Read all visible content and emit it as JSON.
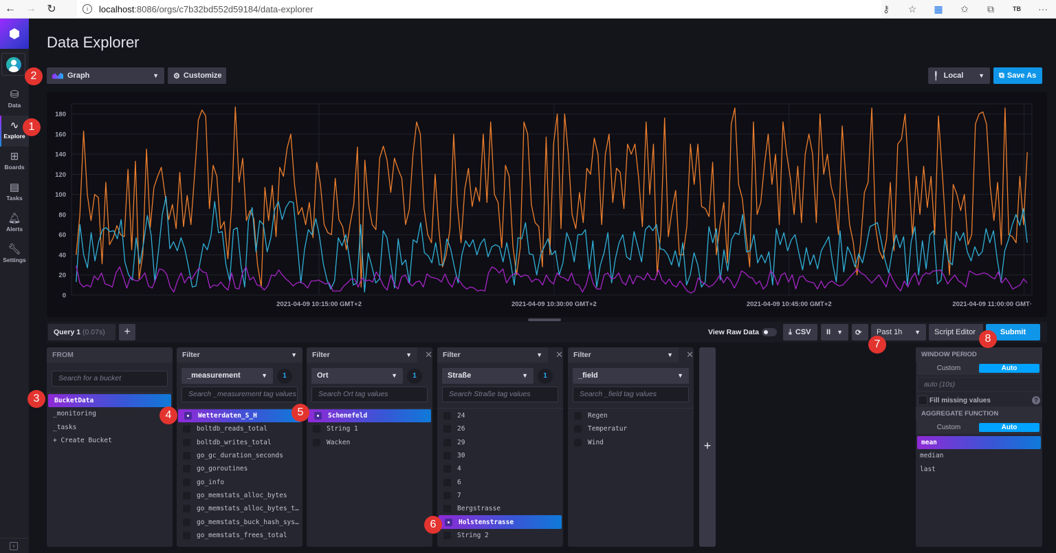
{
  "browser": {
    "url_host": "localhost",
    "url_path": ":8086/orgs/c7b32bd552d59184/data-explorer",
    "profile_initials": "TB"
  },
  "sidebar": {
    "items": [
      {
        "label": "Data",
        "icon": "database-icon"
      },
      {
        "label": "Explore",
        "icon": "explore-graph-icon",
        "active": true
      },
      {
        "label": "Boards",
        "icon": "dashboard-icon"
      },
      {
        "label": "Tasks",
        "icon": "calendar-icon"
      },
      {
        "label": "Alerts",
        "icon": "bell-icon"
      },
      {
        "label": "Settings",
        "icon": "wrench-icon"
      }
    ]
  },
  "page": {
    "title": "Data Explorer",
    "vis_type": "Graph",
    "customize_label": "Customize",
    "timezone": "Local",
    "save_as_label": "Save As"
  },
  "query_bar": {
    "query_tab": "Query 1",
    "query_time": "(0.07s)",
    "add_label": "+",
    "view_raw_label": "View Raw Data",
    "view_raw_on": false,
    "csv_label": "CSV",
    "pause_label": "II",
    "time_range": "Past 1h",
    "script_editor_label": "Script Editor",
    "submit_label": "Submit"
  },
  "from": {
    "header": "FROM",
    "search_placeholder": "Search for a bucket",
    "buckets": [
      "BucketData",
      "_monitoring",
      "_tasks",
      "+ Create Bucket"
    ],
    "selected": "BucketData"
  },
  "filters": [
    {
      "header": "Filter",
      "key": "_measurement",
      "count": "1",
      "search_placeholder": "Search _measurement tag values",
      "values": [
        "Wetterdaten_S_H",
        "boltdb_reads_total",
        "boltdb_writes_total",
        "go_gc_duration_seconds",
        "go_goroutines",
        "go_info",
        "go_memstats_alloc_bytes",
        "go_memstats_alloc_bytes_t…",
        "go_memstats_buck_hash_sys…",
        "go_memstats_frees_total"
      ],
      "selected": [
        "Wetterdaten_S_H"
      ]
    },
    {
      "header": "Filter",
      "key": "Ort",
      "count": "1",
      "search_placeholder": "Search Ort tag values",
      "values": [
        "Schenefeld",
        "String 1",
        "Wacken"
      ],
      "selected": [
        "Schenefeld"
      ]
    },
    {
      "header": "Filter",
      "key": "Straße",
      "count": "1",
      "search_placeholder": "Search Straße tag values",
      "values": [
        "24",
        "26",
        "29",
        "30",
        "4",
        "6",
        "7",
        "Bergstrasse",
        "Holstenstrasse",
        "String 2"
      ],
      "selected": [
        "Holstenstrasse"
      ]
    },
    {
      "header": "Filter",
      "key": "_field",
      "count": "",
      "search_placeholder": "Search _field tag values",
      "values": [
        "Regen",
        "Temperatur",
        "Wind"
      ],
      "selected": []
    }
  ],
  "aggregate": {
    "window_header": "WINDOW PERIOD",
    "custom_label": "Custom",
    "auto_label": "Auto",
    "window_value": "auto (10s)",
    "fill_missing_label": "Fill missing values",
    "fill_missing": false,
    "function_header": "AGGREGATE FUNCTION",
    "functions": [
      "mean",
      "median",
      "last"
    ],
    "selected_function": "mean"
  },
  "annotations": [
    "1",
    "2",
    "3",
    "4",
    "5",
    "6",
    "7",
    "8"
  ],
  "chart_data": {
    "type": "line",
    "title": "",
    "xlabel": "",
    "ylabel": "",
    "ylim": [
      0,
      190
    ],
    "yticks": [
      0,
      20,
      40,
      60,
      80,
      100,
      120,
      140,
      160,
      180
    ],
    "xlim_minutes": [
      -0.8,
      60.5
    ],
    "xticks": [
      {
        "label": "2021-04-09 10:15:00 GMT+2",
        "minute": 15
      },
      {
        "label": "2021-04-09 10:30:00 GMT+2",
        "minute": 30
      },
      {
        "label": "2021-04-09 10:45:00 GMT+2",
        "minute": 45
      },
      {
        "label": "2021-04-09 11:00:00 GMT·",
        "minute": 60
      }
    ],
    "x_start": "2021-04-09 09:59:30 GMT+2",
    "x_step_seconds": 15,
    "grid": true,
    "legend": "none",
    "series": [
      {
        "name": "Regen",
        "color": "#ee7f2e",
        "values": [
          40,
          80,
          163,
          100,
          74,
          100,
          97,
          31,
          112,
          50,
          57,
          69,
          60,
          58,
          125,
          45,
          133,
          16,
          40,
          145,
          67,
          107,
          118,
          127,
          100,
          75,
          90,
          66,
          122,
          68,
          99,
          70,
          120,
          174,
          184,
          178,
          86,
          129,
          118,
          66,
          73,
          36,
          88,
          187,
          112,
          136,
          74,
          84,
          76,
          30,
          8,
          107,
          74,
          109,
          58,
          127,
          118,
          146,
          160,
          110,
          80,
          87,
          70,
          92,
          57,
          132,
          110,
          70,
          62,
          60,
          116,
          75,
          68,
          45,
          70,
          90,
          147,
          8,
          134,
          90,
          70,
          65,
          136,
          148,
          134,
          102,
          136,
          125,
          116,
          70,
          85,
          140,
          172,
          160,
          86,
          60,
          52,
          120,
          66,
          28,
          40,
          66,
          160,
          90,
          52,
          105,
          126,
          88,
          107,
          93,
          160,
          92,
          172,
          100,
          92,
          47,
          129,
          118,
          49,
          20,
          47,
          172,
          160,
          90,
          72,
          68,
          28,
          157,
          40,
          150,
          180,
          66,
          180,
          140,
          80,
          66,
          102,
          72,
          126,
          120,
          156,
          140,
          70,
          140,
          160,
          92,
          126,
          122,
          86,
          150,
          140,
          150,
          116,
          68,
          172,
          100,
          150,
          20,
          64,
          176,
          58,
          84,
          104,
          40,
          40,
          68,
          150,
          110,
          150,
          88,
          86,
          78,
          132,
          40,
          70,
          92,
          32,
          170,
          186,
          110,
          96,
          60,
          28,
          172,
          80,
          92,
          130,
          160,
          110,
          140,
          70,
          172,
          140,
          116,
          80,
          128,
          72,
          140,
          160,
          140,
          72,
          180,
          120,
          140,
          108,
          94,
          60,
          168,
          115,
          70,
          52,
          20,
          53,
          102,
          112,
          186,
          68,
          44,
          36,
          56,
          112,
          44,
          150,
          155,
          180,
          120,
          58,
          118,
          80,
          128,
          87,
          118,
          60,
          178,
          124,
          66,
          20,
          110,
          100,
          84,
          100,
          50,
          60,
          170,
          180,
          182,
          170,
          108,
          74,
          112,
          50,
          186,
          60,
          58,
          52,
          118,
          70,
          142
        ]
      },
      {
        "name": "Temperatur",
        "color": "#31b0d8",
        "values": [
          13,
          70,
          40,
          27,
          62,
          34,
          53,
          65,
          67,
          63,
          64,
          56,
          75,
          33,
          20,
          15,
          57,
          31,
          52,
          79,
          60,
          13,
          45,
          80,
          98,
          46,
          53,
          44,
          57,
          46,
          28,
          8,
          9,
          31,
          51,
          45,
          59,
          93,
          62,
          63,
          30,
          14,
          65,
          67,
          30,
          8,
          74,
          87,
          43,
          74,
          70,
          43,
          57,
          85,
          93,
          75,
          87,
          93,
          92,
          52,
          12,
          46,
          65,
          60,
          76,
          58,
          31,
          15,
          6,
          14,
          57,
          49,
          60,
          36,
          10,
          12,
          70,
          3,
          42,
          28,
          12,
          16,
          64,
          57,
          31,
          7,
          56,
          30,
          35,
          12,
          55,
          52,
          72,
          42,
          39,
          32,
          52,
          30,
          30,
          56,
          46,
          28,
          12,
          40,
          54,
          48,
          55,
          40,
          51,
          56,
          38,
          48,
          50,
          48,
          33,
          52,
          33,
          10,
          57,
          56,
          72,
          41,
          40,
          20,
          40,
          48,
          56,
          40,
          44,
          20,
          32,
          62,
          52,
          33,
          60,
          60,
          65,
          25,
          54,
          8,
          30,
          42,
          62,
          12,
          36,
          52,
          60,
          38,
          35,
          63,
          48,
          33,
          65,
          69,
          64,
          70,
          46,
          45,
          40,
          30,
          44,
          28,
          52,
          10,
          20,
          42,
          30,
          8,
          13,
          68,
          52,
          66,
          15,
          45,
          24,
          55,
          62,
          60,
          80,
          43,
          44,
          60,
          32,
          40,
          32,
          43,
          10,
          66,
          50,
          62,
          44,
          55,
          60,
          42,
          25,
          47,
          30,
          40,
          26,
          44,
          51,
          58,
          32,
          13,
          64,
          23,
          48,
          40,
          28,
          41,
          32,
          49,
          68,
          70,
          72,
          54,
          35,
          22,
          45,
          60,
          47,
          58,
          10,
          53,
          68,
          20,
          54,
          26,
          60,
          64,
          11,
          15,
          56,
          34,
          30,
          63,
          54,
          62,
          43,
          34,
          48,
          39,
          43,
          66,
          52,
          64,
          35,
          13,
          44,
          55,
          70,
          80,
          69,
          86,
          52
        ]
      },
      {
        "name": "Wind",
        "color": "#a624c7",
        "values": [
          29,
          12,
          8,
          10,
          8,
          19,
          15,
          22,
          11,
          10,
          8,
          22,
          28,
          18,
          7,
          18,
          15,
          14,
          17,
          22,
          9,
          7,
          16,
          26,
          25,
          21,
          8,
          3,
          14,
          22,
          12,
          18,
          16,
          22,
          27,
          23,
          22,
          7,
          10,
          9,
          13,
          8,
          5,
          22,
          7,
          6,
          22,
          28,
          15,
          18,
          10,
          9,
          5,
          9,
          20,
          19,
          25,
          20,
          16,
          13,
          9,
          12,
          13,
          11,
          7,
          14,
          14,
          15,
          13,
          11,
          12,
          4,
          4,
          4,
          9,
          12,
          16,
          16,
          8,
          17,
          14,
          15,
          13,
          23,
          17,
          9,
          5,
          20,
          10,
          6,
          18,
          20,
          12,
          9,
          13,
          14,
          8,
          21,
          18,
          17,
          16,
          13,
          21,
          12,
          8,
          18,
          14,
          9,
          6,
          8,
          7,
          4,
          5,
          4,
          22,
          28,
          26,
          22,
          26,
          12,
          18,
          21,
          22,
          18,
          20,
          19,
          13,
          16,
          15,
          10,
          20,
          14,
          11,
          22,
          18,
          17,
          14,
          22,
          11,
          10,
          3,
          10,
          24,
          11,
          6,
          6,
          20,
          22,
          16,
          17,
          22,
          13,
          10,
          20,
          11,
          19,
          18,
          15,
          22,
          16,
          15,
          25,
          15,
          11,
          16,
          10,
          8,
          14,
          9,
          4,
          2,
          4,
          17,
          13,
          11,
          8,
          10,
          14,
          20,
          12,
          18,
          14,
          7,
          14,
          24,
          22,
          18,
          17,
          11,
          14,
          6,
          10,
          24,
          20,
          10,
          20,
          22,
          13,
          20,
          6,
          18,
          19,
          14,
          13,
          12,
          6,
          14,
          7,
          12,
          14,
          11,
          9,
          10,
          14,
          18,
          22,
          26,
          22,
          20,
          16,
          12,
          16,
          20,
          14,
          8,
          22,
          14,
          8,
          4,
          14,
          8,
          17,
          22,
          10,
          19,
          22,
          21,
          24,
          24,
          25,
          19,
          11,
          16,
          20,
          14,
          12,
          8,
          24,
          22,
          20,
          21,
          22,
          21,
          18,
          16,
          23,
          12,
          17,
          12,
          6,
          8,
          10,
          16,
          12
        ]
      }
    ]
  }
}
